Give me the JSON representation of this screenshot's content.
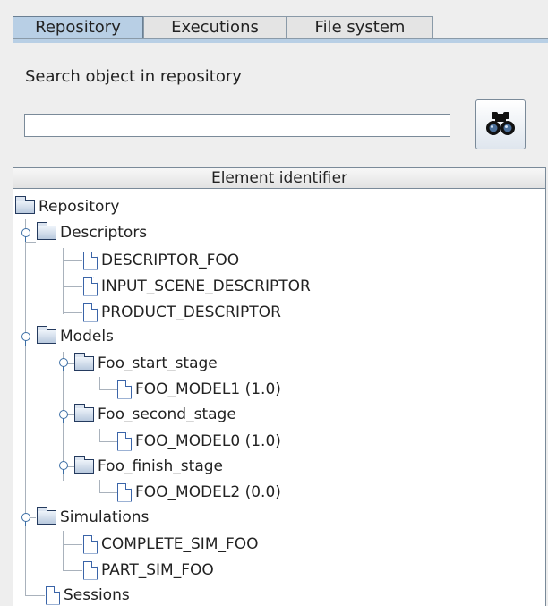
{
  "tabs": [
    {
      "label": "Repository",
      "active": true
    },
    {
      "label": "Executions",
      "active": false
    },
    {
      "label": "File system",
      "active": false
    }
  ],
  "search": {
    "label": "Search object in repository",
    "value": "",
    "button_icon": "binoculars-icon"
  },
  "table": {
    "column_header": "Element identifier"
  },
  "tree": {
    "root": "Repository",
    "descriptors": {
      "label": "Descriptors",
      "items": [
        "DESCRIPTOR_FOO",
        "INPUT_SCENE_DESCRIPTOR",
        "PRODUCT_DESCRIPTOR"
      ]
    },
    "models": {
      "label": "Models",
      "stages": [
        {
          "label": "Foo_start_stage",
          "model": "FOO_MODEL1 (1.0)"
        },
        {
          "label": "Foo_second_stage",
          "model": "FOO_MODEL0 (1.0)"
        },
        {
          "label": "Foo_finish_stage",
          "model": "FOO_MODEL2 (0.0)"
        }
      ]
    },
    "simulations": {
      "label": "Simulations",
      "items": [
        "COMPLETE_SIM_FOO",
        "PART_SIM_FOO"
      ]
    },
    "sessions": "Sessions"
  },
  "colors": {
    "active_tab": "#b8cfe5",
    "folder_outline": "#243a5e",
    "document_outline": "#3a64a8"
  }
}
